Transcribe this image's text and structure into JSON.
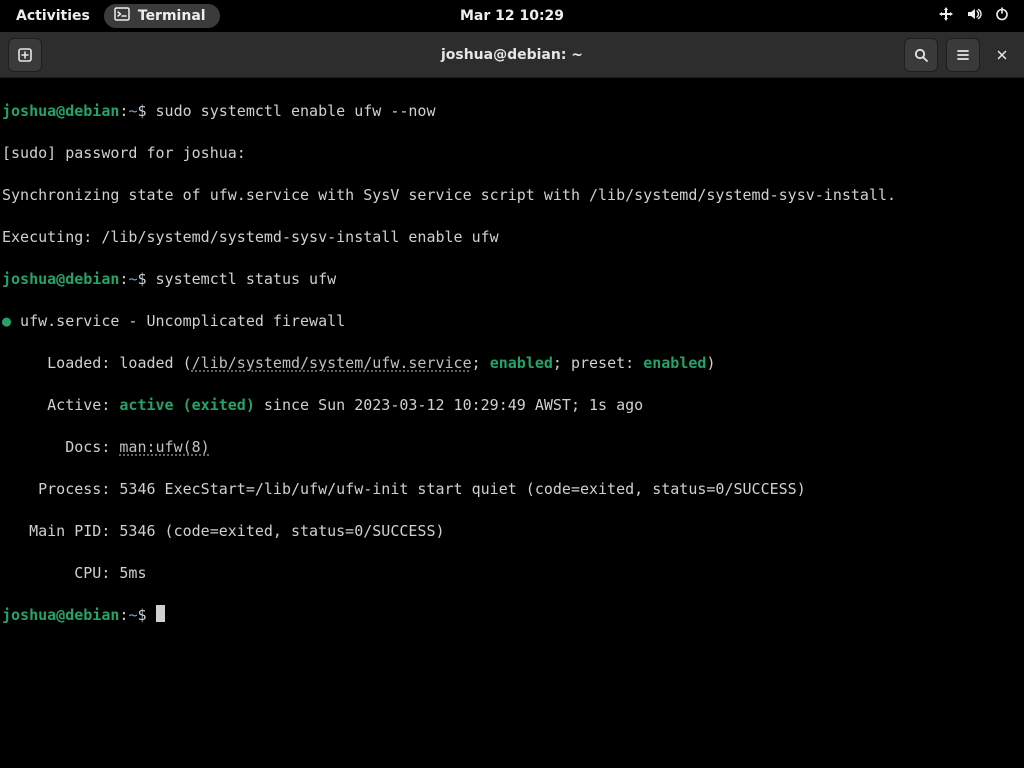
{
  "panel": {
    "activities": "Activities",
    "app_name": "Terminal",
    "clock": "Mar 12  10:29"
  },
  "window": {
    "title": "joshua@debian: ~"
  },
  "prompt": {
    "userhost": "joshua@debian",
    "sep": ":",
    "path": "~",
    "sigil": "$"
  },
  "lines": {
    "cmd1": "sudo systemctl enable ufw --now",
    "sudo_pw": "[sudo] password for joshua:",
    "sync": "Synchronizing state of ufw.service with SysV service script with /lib/systemd/systemd-sysv-install.",
    "exec": "Executing: /lib/systemd/systemd-sysv-install enable ufw",
    "cmd2": "systemctl status ufw",
    "svc_title": " ufw.service - Uncomplicated firewall",
    "loaded_pre": "     Loaded: loaded (",
    "loaded_path": "/lib/systemd/system/ufw.service",
    "loaded_mid1": "; ",
    "loaded_en1": "enabled",
    "loaded_mid2": "; preset: ",
    "loaded_en2": "enabled",
    "loaded_post": ")",
    "active_pre": "     Active: ",
    "active_state": "active (exited)",
    "active_post": " since Sun 2023-03-12 10:29:49 AWST; 1s ago",
    "docs_pre": "       Docs: ",
    "docs_link": "man:ufw(8)",
    "process": "    Process: 5346 ExecStart=/lib/ufw/ufw-init start quiet (code=exited, status=0/SUCCESS)",
    "mainpid": "   Main PID: 5346 (code=exited, status=0/SUCCESS)",
    "cpu": "        CPU: 5ms"
  }
}
